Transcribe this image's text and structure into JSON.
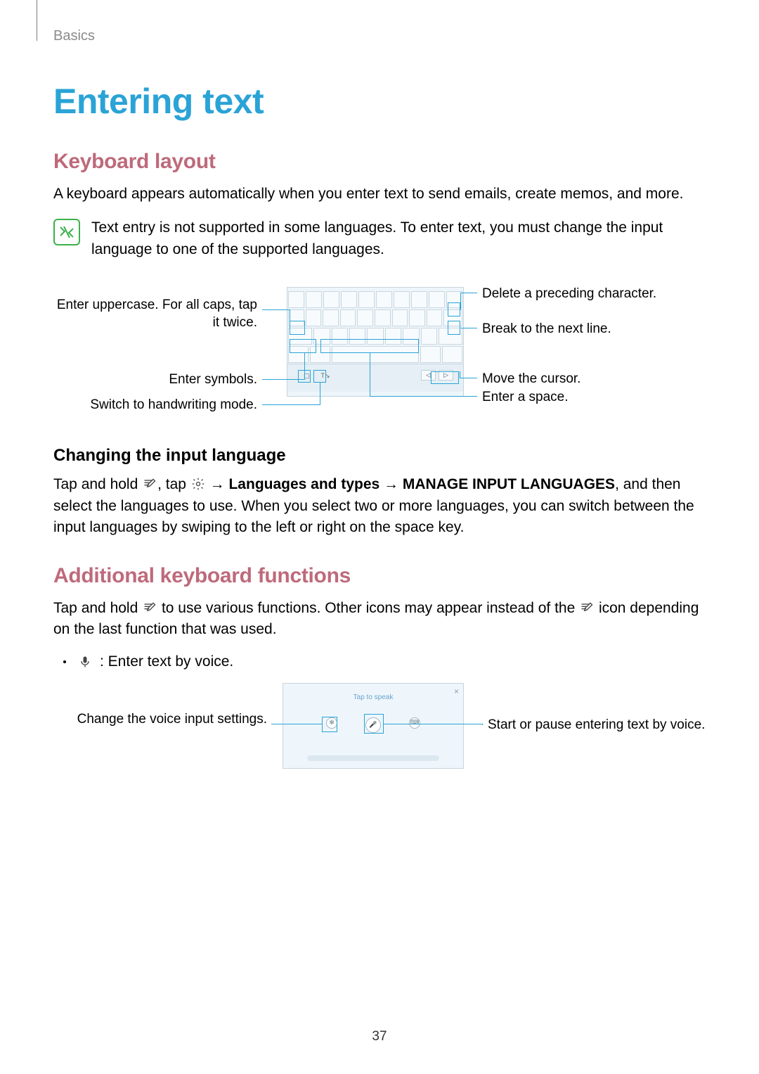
{
  "breadcrumb": "Basics",
  "title": "Entering text",
  "section1": {
    "heading": "Keyboard layout",
    "intro": "A keyboard appears automatically when you enter text to send emails, create memos, and more.",
    "note": "Text entry is not supported in some languages. To enter text, you must change the input language to one of the supported languages."
  },
  "kbd_callouts": {
    "left1": "Enter uppercase. For all caps, tap it twice.",
    "left2": "Enter symbols.",
    "left3": "Switch to handwriting mode.",
    "right1": "Delete a preceding character.",
    "right2": "Break to the next line.",
    "right3": "Move the cursor.",
    "right4": "Enter a space."
  },
  "subsection1": {
    "heading": "Changing the input language",
    "p_parts": {
      "a": "Tap and hold ",
      "b": ", tap ",
      "c": " → ",
      "d": "Languages and types",
      "e": " → ",
      "f": "MANAGE INPUT LANGUAGES",
      "g": ", and then select the languages to use. When you select two or more languages, you can switch between the input languages by swiping to the left or right on the space key."
    }
  },
  "section2": {
    "heading": "Additional keyboard functions",
    "p_parts": {
      "a": "Tap and hold ",
      "b": " to use various functions. Other icons may appear instead of the ",
      "c": " icon depending on the last function that was used."
    }
  },
  "bullet1": ": Enter text by voice.",
  "voice_callouts": {
    "left": "Change the voice input settings.",
    "right": "Start or pause entering text by voice."
  },
  "voice_panel": {
    "tap": "Tap to speak",
    "close": "×"
  },
  "page_number": "37"
}
